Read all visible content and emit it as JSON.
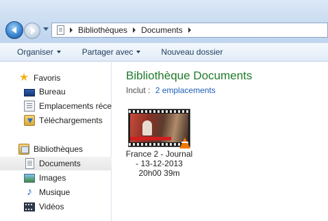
{
  "breadcrumbs": [
    "Bibliothèques",
    "Documents"
  ],
  "toolbar": {
    "organize": "Organiser",
    "share": "Partager avec",
    "new_folder": "Nouveau dossier"
  },
  "sidebar": {
    "favorites": {
      "label": "Favoris",
      "items": [
        "Bureau",
        "Emplacements récents",
        "Téléchargements"
      ]
    },
    "libraries": {
      "label": "Bibliothèques",
      "items": [
        "Documents",
        "Images",
        "Musique",
        "Vidéos"
      ],
      "selected": "Documents"
    }
  },
  "main": {
    "title": "Bibliothèque Documents",
    "include_label": "Inclut :",
    "include_link": "2 emplacements",
    "files": [
      {
        "name_lines": [
          "France 2 - Journal",
          "- 13-12-2013",
          "20h00 39m"
        ],
        "icon": "vlc-icon"
      }
    ]
  },
  "colors": {
    "title_green": "#1e7b2a",
    "link_blue": "#1c5fb5",
    "chrome_blue": "#c9dcf1"
  }
}
